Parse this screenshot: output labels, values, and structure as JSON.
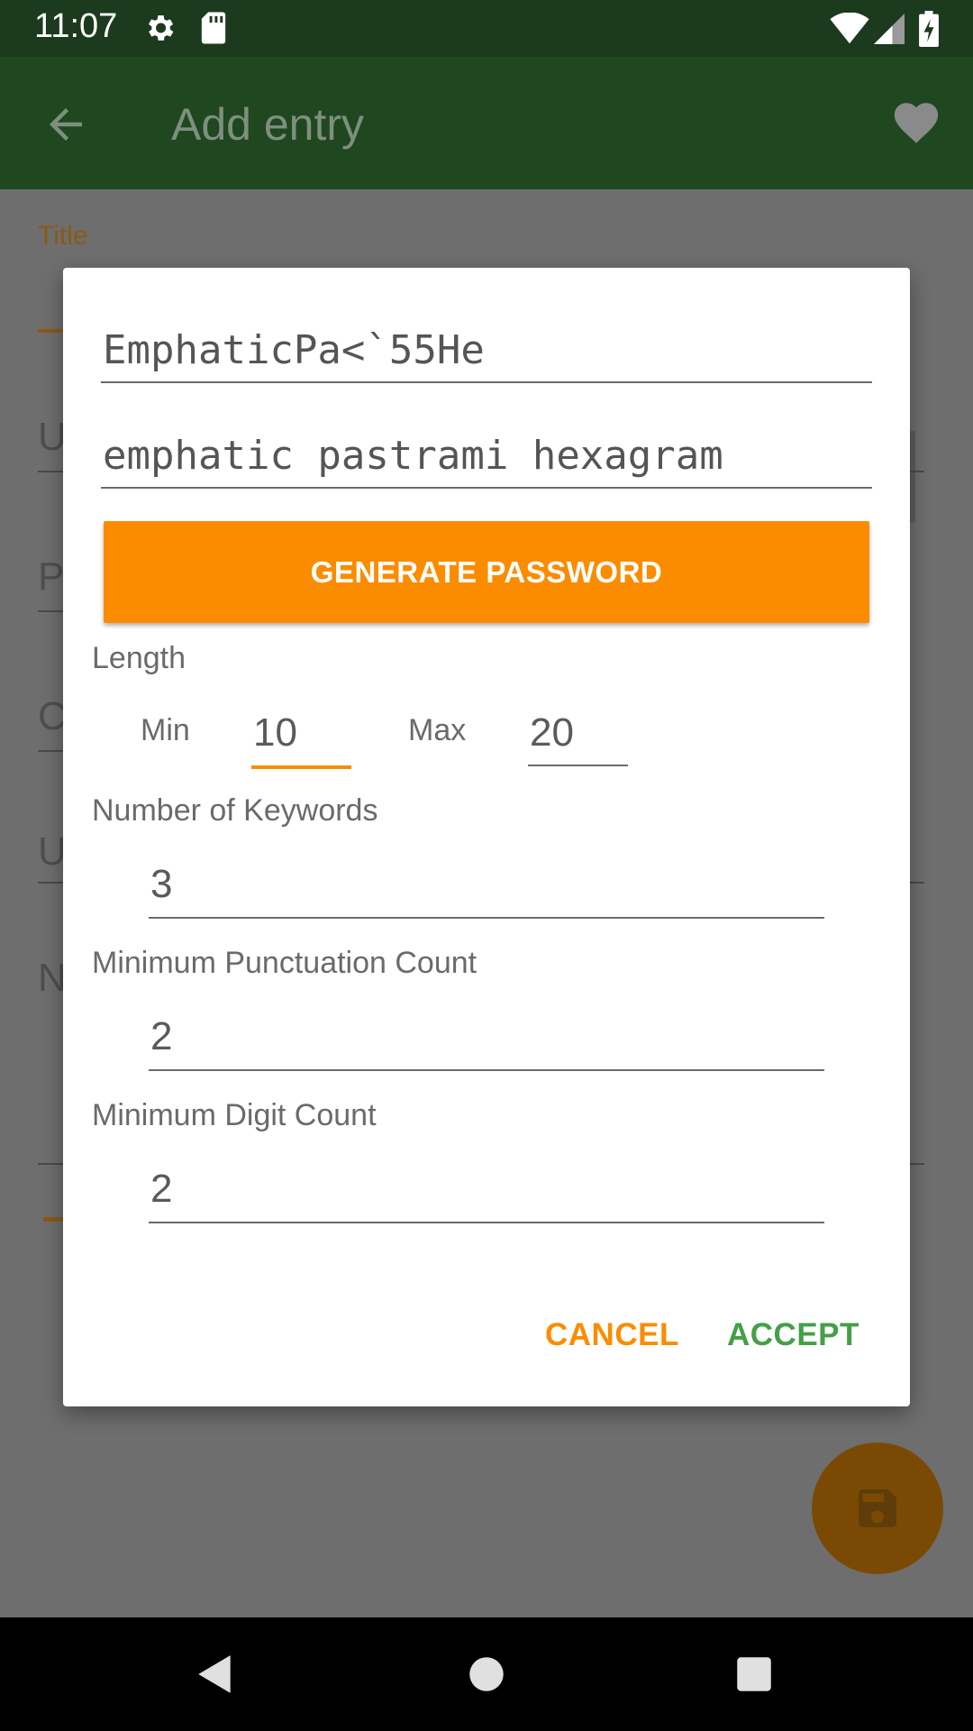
{
  "status_bar": {
    "time": "11:07",
    "icons": [
      "gear-icon",
      "sd-card-icon",
      "wifi-icon",
      "signal-icon",
      "battery-icon"
    ]
  },
  "app_bar": {
    "title": "Add entry",
    "icons": [
      "back-arrow-icon",
      "heart-icon"
    ]
  },
  "background_form": {
    "title_label": "Title",
    "letters": [
      "U",
      "P",
      "C",
      "U",
      "N"
    ]
  },
  "dialog": {
    "generated_password": "EmphaticPa<`55He",
    "passphrase": "emphatic pastrami hexagram",
    "generate_button": "GENERATE PASSWORD",
    "length_label": "Length",
    "min_label": "Min",
    "min_value": "10",
    "max_label": "Max",
    "max_value": "20",
    "keywords_label": "Number of Keywords",
    "keywords_value": "3",
    "punct_label": "Minimum Punctuation Count",
    "punct_value": "2",
    "digit_label": "Minimum Digit Count",
    "digit_value": "2",
    "cancel": "CANCEL",
    "accept": "ACCEPT"
  },
  "colors": {
    "accent": "#fb8c00",
    "positive": "#43a047",
    "app_bar": "#1b5e20"
  }
}
